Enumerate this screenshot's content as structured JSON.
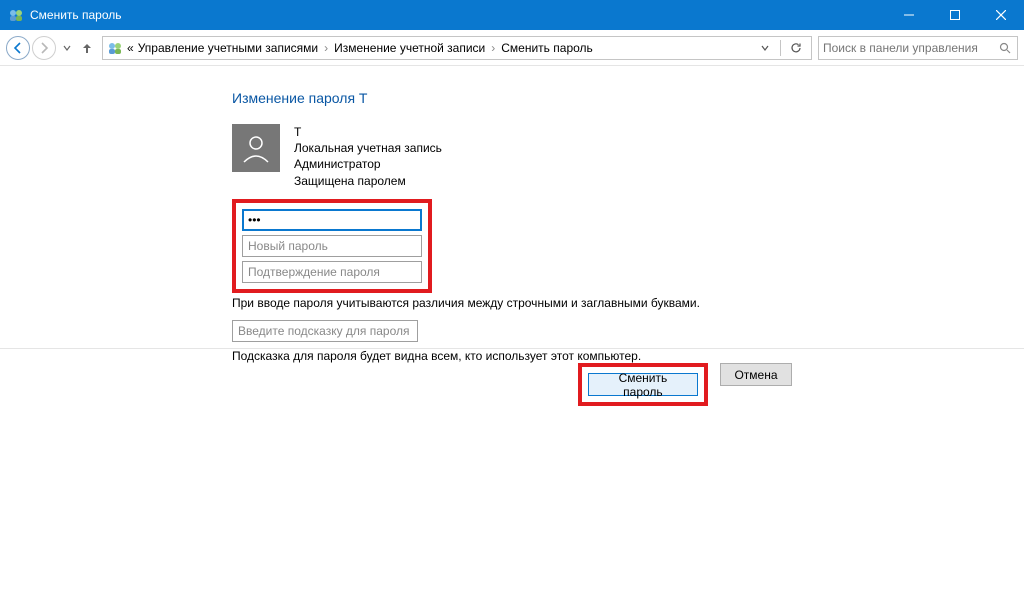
{
  "window": {
    "title": "Сменить пароль"
  },
  "nav": {
    "breadcrumb_prefix": "«",
    "crumb1": "Управление учетными записями",
    "crumb2": "Изменение учетной записи",
    "crumb3": "Сменить пароль"
  },
  "search": {
    "placeholder": "Поиск в панели управления"
  },
  "page": {
    "heading": "Изменение пароля T",
    "username": "T",
    "account_type": "Локальная учетная запись",
    "role": "Администратор",
    "protection": "Защищена паролем",
    "current_password_value": "•••",
    "new_password_placeholder": "Новый пароль",
    "confirm_password_placeholder": "Подтверждение пароля",
    "case_sensitive_note": "При вводе пароля учитываются различия между строчными и заглавными буквами.",
    "hint_placeholder": "Введите подсказку для пароля",
    "hint_note": "Подсказка для пароля будет видна всем, кто использует этот компьютер."
  },
  "buttons": {
    "change": "Сменить пароль",
    "cancel": "Отмена"
  }
}
